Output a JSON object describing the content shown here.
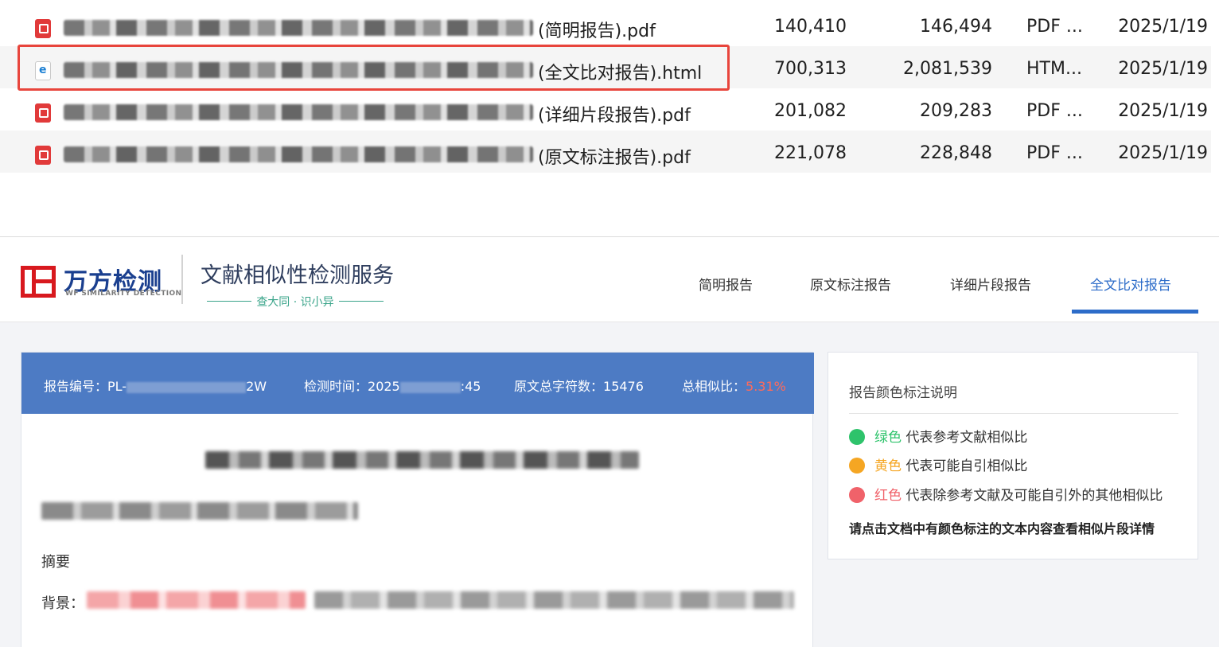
{
  "file_list": {
    "rows": [
      {
        "name_suffix": "(简明报告).pdf",
        "size_a": "140,410",
        "size_b": "146,494",
        "type": "PDF ...",
        "date": "2025/1/19",
        "icon": "pdf-file-icon"
      },
      {
        "name_suffix": "(全文比对报告).html",
        "size_a": "700,313",
        "size_b": "2,081,539",
        "type": "HTM...",
        "date": "2025/1/19",
        "icon": "html-file-icon",
        "selected": true
      },
      {
        "name_suffix": "(详细片段报告).pdf",
        "size_a": "201,082",
        "size_b": "209,283",
        "type": "PDF ...",
        "date": "2025/1/19",
        "icon": "pdf-file-icon"
      },
      {
        "name_suffix": "(原文标注报告).pdf",
        "size_a": "221,078",
        "size_b": "228,848",
        "type": "PDF ...",
        "date": "2025/1/19",
        "icon": "pdf-file-icon"
      }
    ],
    "highlight_color": "#e8453c"
  },
  "report": {
    "brand": {
      "name": "万方检测",
      "subtitle_en": "WF SIMILARITY DETECTION",
      "color": "#1a3f8f",
      "mark_color": "#d8191e"
    },
    "service_title": "文献相似性检测服务",
    "slogan": "查大同 · 识小异",
    "tabs": [
      {
        "label": "简明报告",
        "active": false
      },
      {
        "label": "原文标注报告",
        "active": false
      },
      {
        "label": "详细片段报告",
        "active": false
      },
      {
        "label": "全文比对报告",
        "active": true
      }
    ],
    "accent_color": "#2d6cc9",
    "infobar": {
      "report_no_label": "报告编号：",
      "report_no_prefix": "PL-",
      "report_no_suffix": "2W",
      "check_time_label": "检测时间：",
      "check_time_prefix": "2025",
      "check_time_suffix": ":45",
      "char_count_label": "原文总字符数：",
      "char_count": "15476",
      "similarity_label": "总相似比：",
      "similarity": "5.31%",
      "bg_color": "#4d7bc4"
    },
    "document": {
      "abstract_heading": "摘要",
      "background_label": "背景："
    },
    "legend": {
      "title": "报告颜色标注说明",
      "items": [
        {
          "color_word": "绿色",
          "desc": "代表参考文献相似比",
          "color": "#2ec36b"
        },
        {
          "color_word": "黄色",
          "desc": "代表可能自引相似比",
          "color": "#f5a623"
        },
        {
          "color_word": "红色",
          "desc": "代表除参考文献及可能自引外的其他相似比",
          "color": "#f0626a"
        }
      ],
      "note": "请点击文档中有颜色标注的文本内容查看相似片段详情"
    }
  }
}
